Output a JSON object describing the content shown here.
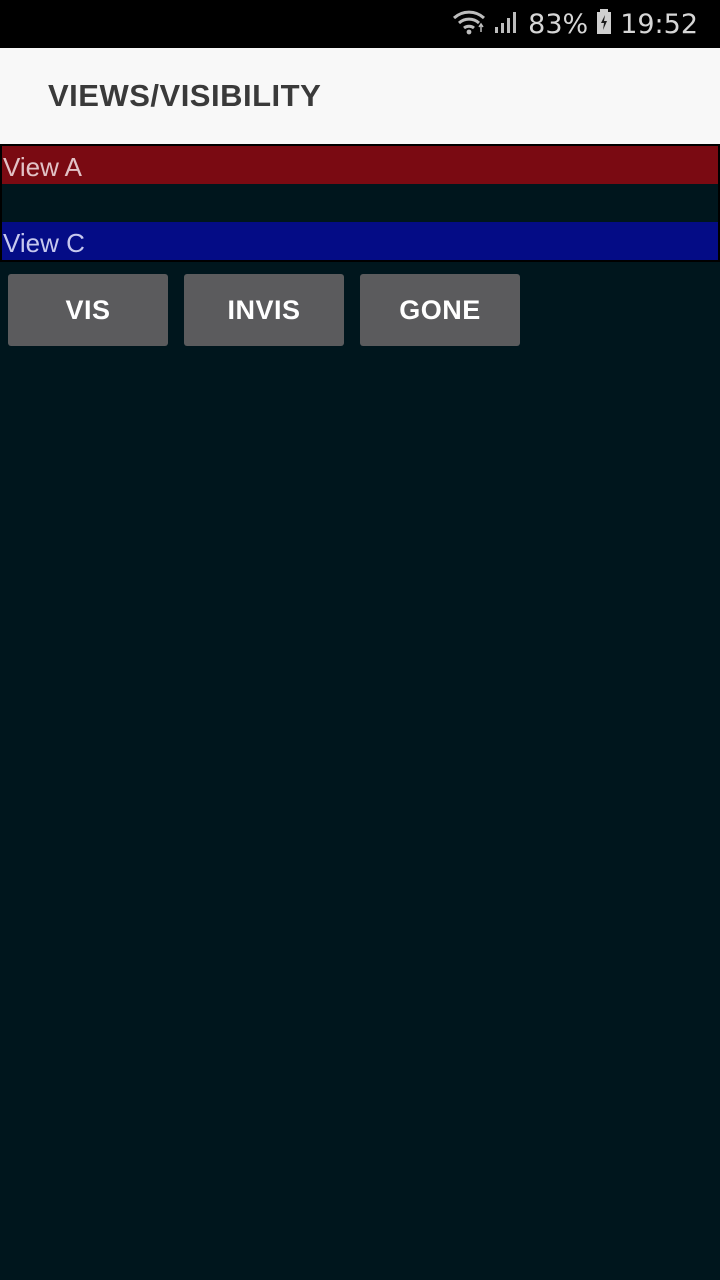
{
  "status_bar": {
    "battery": "83%",
    "time": "19:52",
    "icons": [
      "wifi-icon",
      "signal-icon",
      "battery-icon"
    ]
  },
  "app_bar": {
    "title": "VIEWS/VISIBILITY"
  },
  "views": {
    "view_a": "View A",
    "view_c": "View C"
  },
  "buttons": {
    "vis": "VIS",
    "invis": "INVIS",
    "gone": "GONE"
  },
  "colors": {
    "view_a_bg": "#7a0a12",
    "view_c_bg": "#040c86",
    "background": "#00161d",
    "button_bg": "#5b5b5d",
    "app_bar_bg": "#f8f8f8"
  }
}
